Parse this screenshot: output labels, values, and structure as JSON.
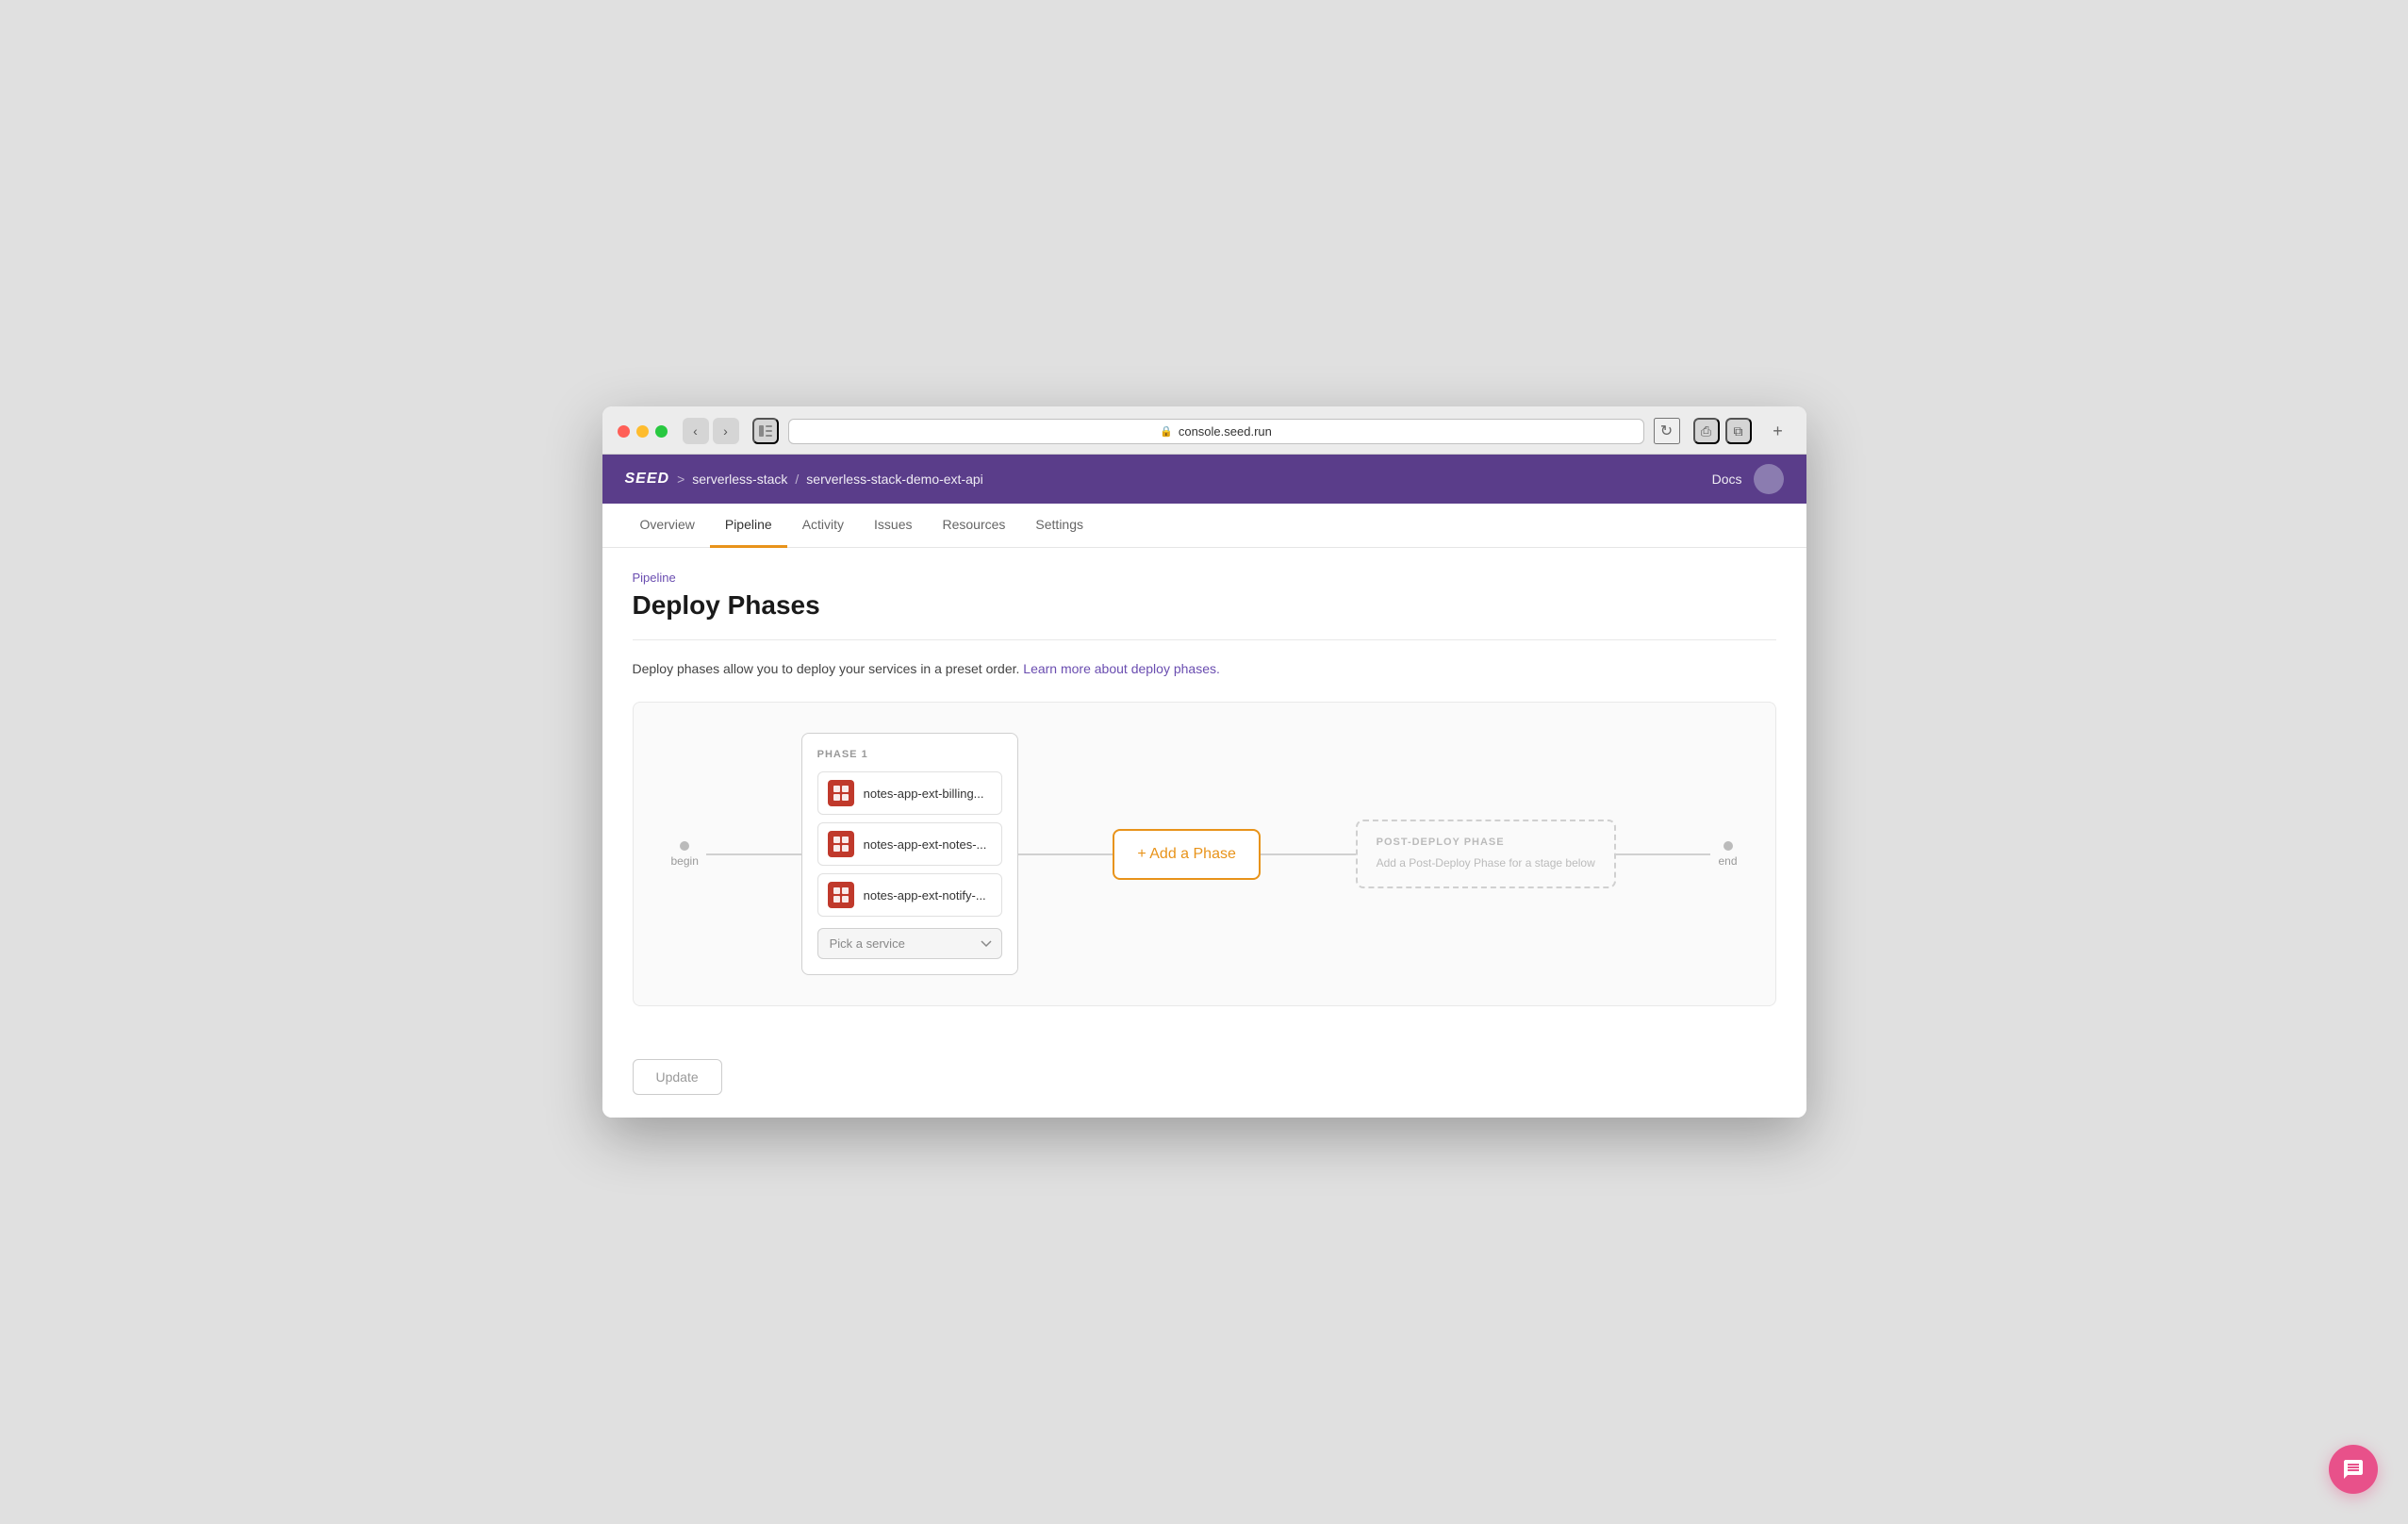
{
  "browser": {
    "url": "console.seed.run",
    "back_btn": "‹",
    "forward_btn": "›"
  },
  "header": {
    "logo": "SEED",
    "breadcrumb1": "serverless-stack",
    "breadcrumb2": "serverless-stack-demo-ext-api",
    "sep": ">",
    "docs_label": "Docs"
  },
  "tabs": [
    {
      "label": "Overview",
      "active": false
    },
    {
      "label": "Pipeline",
      "active": true
    },
    {
      "label": "Activity",
      "active": false
    },
    {
      "label": "Issues",
      "active": false
    },
    {
      "label": "Resources",
      "active": false
    },
    {
      "label": "Settings",
      "active": false
    }
  ],
  "page": {
    "breadcrumb": "Pipeline",
    "title": "Deploy Phases",
    "description_start": "Deploy phases allow you to deploy your services in a preset order. ",
    "description_link": "Learn more about deploy phases.",
    "description_link_url": "#"
  },
  "pipeline": {
    "begin_label": "begin",
    "end_label": "end",
    "phase1_label": "PHASE 1",
    "services": [
      {
        "name": "notes-app-ext-billing..."
      },
      {
        "name": "notes-app-ext-notes-..."
      },
      {
        "name": "notes-app-ext-notify-..."
      }
    ],
    "pick_service_placeholder": "Pick a service",
    "pick_service_options": [
      "Pick a service",
      "notes-app-ext-billing",
      "notes-app-ext-notes",
      "notes-app-ext-notify"
    ],
    "add_phase_label": "+ Add a Phase",
    "post_deploy_label": "POST-DEPLOY PHASE",
    "post_deploy_text": "Add a Post-Deploy Phase for a stage below"
  },
  "update_button": "Update",
  "chat_icon": "💬"
}
